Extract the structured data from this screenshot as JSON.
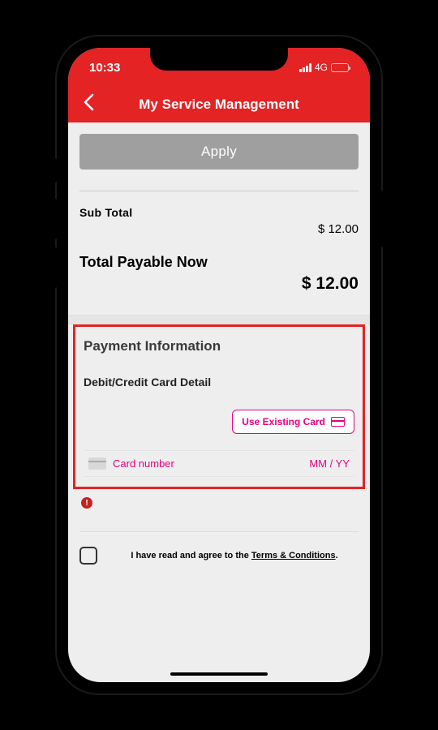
{
  "status": {
    "time": "10:33",
    "network": "4G"
  },
  "nav": {
    "title": "My Service Management"
  },
  "apply": {
    "label": "Apply"
  },
  "summary": {
    "subtotal_label": "Sub Total",
    "subtotal_value": "$ 12.00",
    "total_label": "Total Payable Now",
    "total_value": "$ 12.00"
  },
  "payment": {
    "title": "Payment Information",
    "card_detail_label": "Debit/Credit Card Detail",
    "use_existing_label": "Use Existing Card",
    "card_number_placeholder": "Card number",
    "expiry_placeholder": "MM / YY"
  },
  "terms": {
    "prefix": "I have read and agree to the ",
    "link": "Terms & Conditions",
    "suffix": "."
  }
}
